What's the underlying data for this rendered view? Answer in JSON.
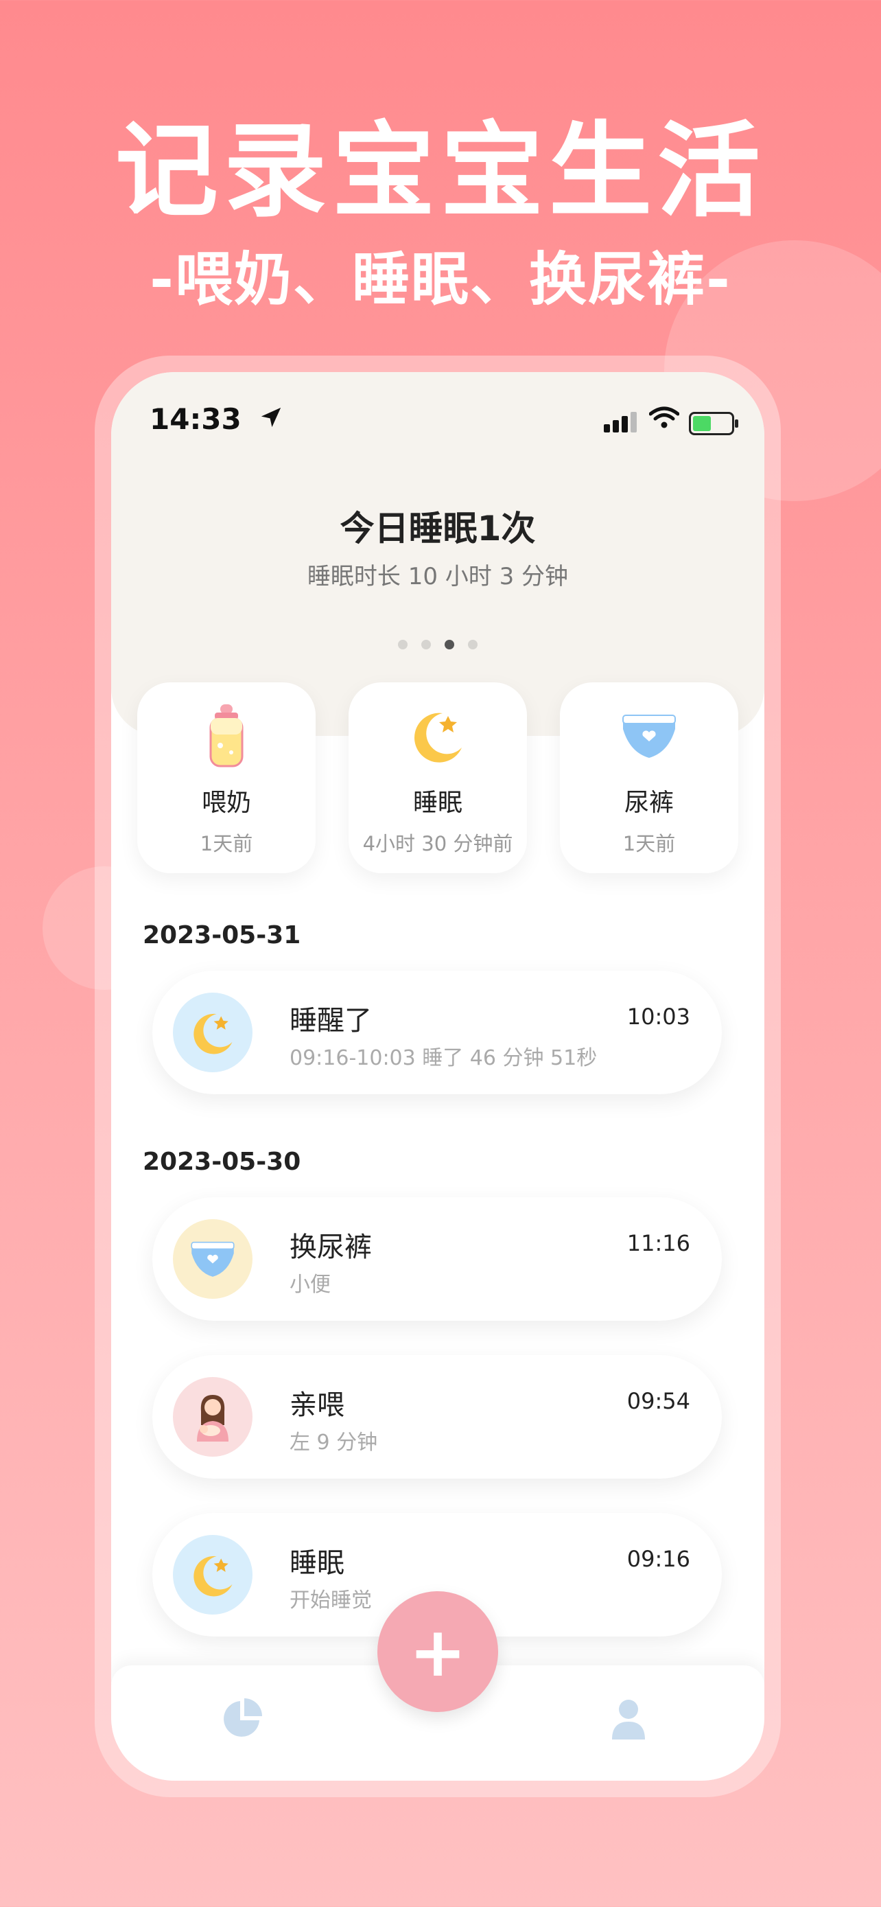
{
  "hero": {
    "title": "记录宝宝生活",
    "subtitle": "-喂奶、睡眠、换尿裤-"
  },
  "status_bar": {
    "time": "14:33",
    "battery_color": "#4cd964"
  },
  "summary": {
    "headline": "今日睡眠1次",
    "subline": "睡眠时长 10 小时 3 分钟",
    "page_count": 4,
    "active_page": 3
  },
  "quick_cards": [
    {
      "icon": "baby-bottle-icon",
      "label": "喂奶",
      "time": "1天前"
    },
    {
      "icon": "moon-icon",
      "label": "睡眠",
      "time": "4小时 30 分钟前"
    },
    {
      "icon": "diaper-icon",
      "label": "尿裤",
      "time": "1天前"
    }
  ],
  "groups": [
    {
      "date": "2023-05-31",
      "entries": [
        {
          "icon": "moon-icon",
          "title": "睡醒了",
          "detail": "09:16-10:03  睡了 46 分钟 51秒",
          "time": "10:03"
        }
      ]
    },
    {
      "date": "2023-05-30",
      "entries": [
        {
          "icon": "diaper-icon",
          "title": "换尿裤",
          "detail": "小便",
          "time": "11:16"
        },
        {
          "icon": "breastfeeding-icon",
          "title": "亲喂",
          "detail": "左 9 分钟",
          "time": "09:54"
        },
        {
          "icon": "moon-icon",
          "title": "睡眠",
          "detail": "开始睡觉",
          "time": "09:16"
        }
      ]
    }
  ],
  "tab_bar": {
    "left_icon": "pie-chart-icon",
    "center_icon": "plus-icon",
    "center_label": "+",
    "right_icon": "person-icon"
  },
  "colors": {
    "background_top": "#ff8a8e",
    "background_bottom": "#ffc1c2",
    "add_button": "#f5a9b3",
    "moon_avatar_bg": "#d8eefc",
    "diaper_avatar_bg": "#fbefcc",
    "feed_avatar_bg": "#fadedf"
  }
}
